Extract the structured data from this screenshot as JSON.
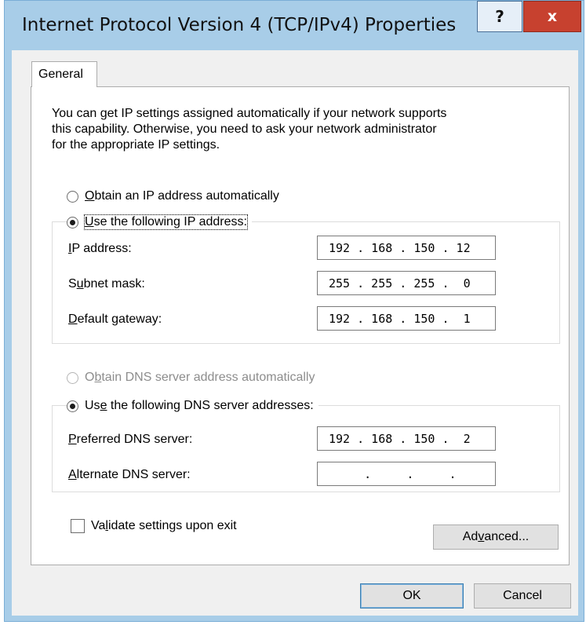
{
  "window": {
    "title": "Internet Protocol Version 4 (TCP/IPv4) Properties",
    "help_button": "?",
    "close_button": "x"
  },
  "tabs": [
    {
      "label": "General",
      "selected": true
    }
  ],
  "intro_text": "You can get IP settings assigned automatically if your network supports\nthis capability. Otherwise, you need to ask your network administrator\nfor the appropriate IP settings.",
  "ip_options": {
    "auto": {
      "pre": "",
      "key": "O",
      "post": "btain an IP address automatically",
      "checked": false
    },
    "manual": {
      "pre": "",
      "key": "U",
      "post": "se the following IP address:",
      "checked": true
    }
  },
  "ip_fields": [
    {
      "label_pre": "",
      "key": "I",
      "label_post": "P address:",
      "value": "192 . 168 . 150 . 12"
    },
    {
      "label_pre": "S",
      "key": "u",
      "label_post": "bnet mask:",
      "value": "255 . 255 . 255 .  0"
    },
    {
      "label_pre": "",
      "key": "D",
      "label_post": "efault gateway:",
      "value": "192 . 168 . 150 .  1"
    }
  ],
  "dns_options": {
    "auto": {
      "pre": "O",
      "key": "b",
      "post": "tain DNS server address automatically",
      "checked": false,
      "disabled": true
    },
    "manual": {
      "pre": "Us",
      "key": "e",
      "post": " the following DNS server addresses:",
      "checked": true
    }
  },
  "dns_fields": [
    {
      "label_pre": "",
      "key": "P",
      "label_post": "referred DNS server:",
      "value": "192 . 168 . 150 .  2"
    },
    {
      "label_pre": "",
      "key": "A",
      "label_post": "lternate DNS server:",
      "value": "     .     .     ."
    }
  ],
  "validate_checkbox": {
    "pre": "Va",
    "key": "l",
    "post": "idate settings upon exit",
    "checked": false
  },
  "buttons": {
    "advanced": {
      "pre": "Ad",
      "key": "v",
      "post": "anced..."
    },
    "ok": "OK",
    "cancel": "Cancel"
  }
}
